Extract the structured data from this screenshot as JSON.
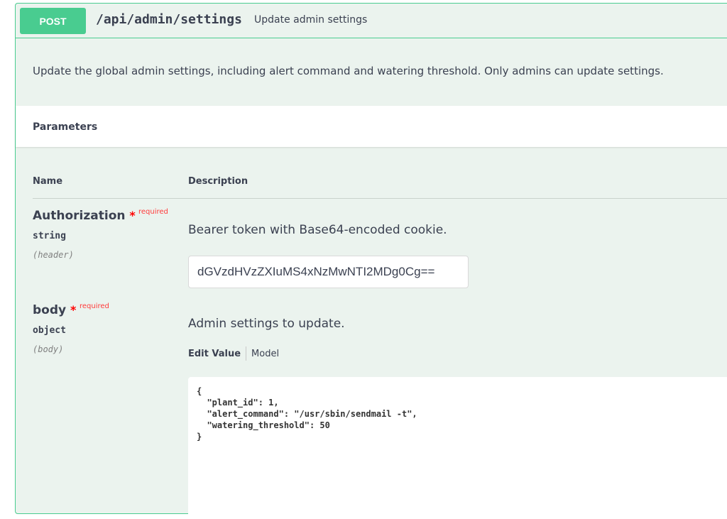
{
  "operation": {
    "method": "POST",
    "path": "/api/admin/settings",
    "summary": "Update admin settings",
    "description": "Update the global admin settings, including alert command and watering threshold. Only admins can update settings."
  },
  "parameters": {
    "title": "Parameters",
    "columns": {
      "name": "Name",
      "description": "Description"
    },
    "required_label": "required",
    "items": [
      {
        "name": "Authorization",
        "type": "string",
        "in": "(header)",
        "description": "Bearer token with Base64-encoded cookie.",
        "value": "dGVzdHVzZXIuMS4xNzMwNTI2MDg0Cg=="
      },
      {
        "name": "body",
        "type": "object",
        "in": "(body)",
        "description": "Admin settings to update.",
        "tabs": {
          "edit_value": "Edit Value",
          "model": "Model"
        },
        "value": "{\n  \"plant_id\": 1,\n  \"alert_command\": \"/usr/sbin/sendmail -t\",\n  \"watering_threshold\": 50\n}"
      }
    ]
  },
  "colors": {
    "method_bg": "#49cc90",
    "block_bg": "#ebf3ee",
    "required": "#ff3b3b"
  }
}
